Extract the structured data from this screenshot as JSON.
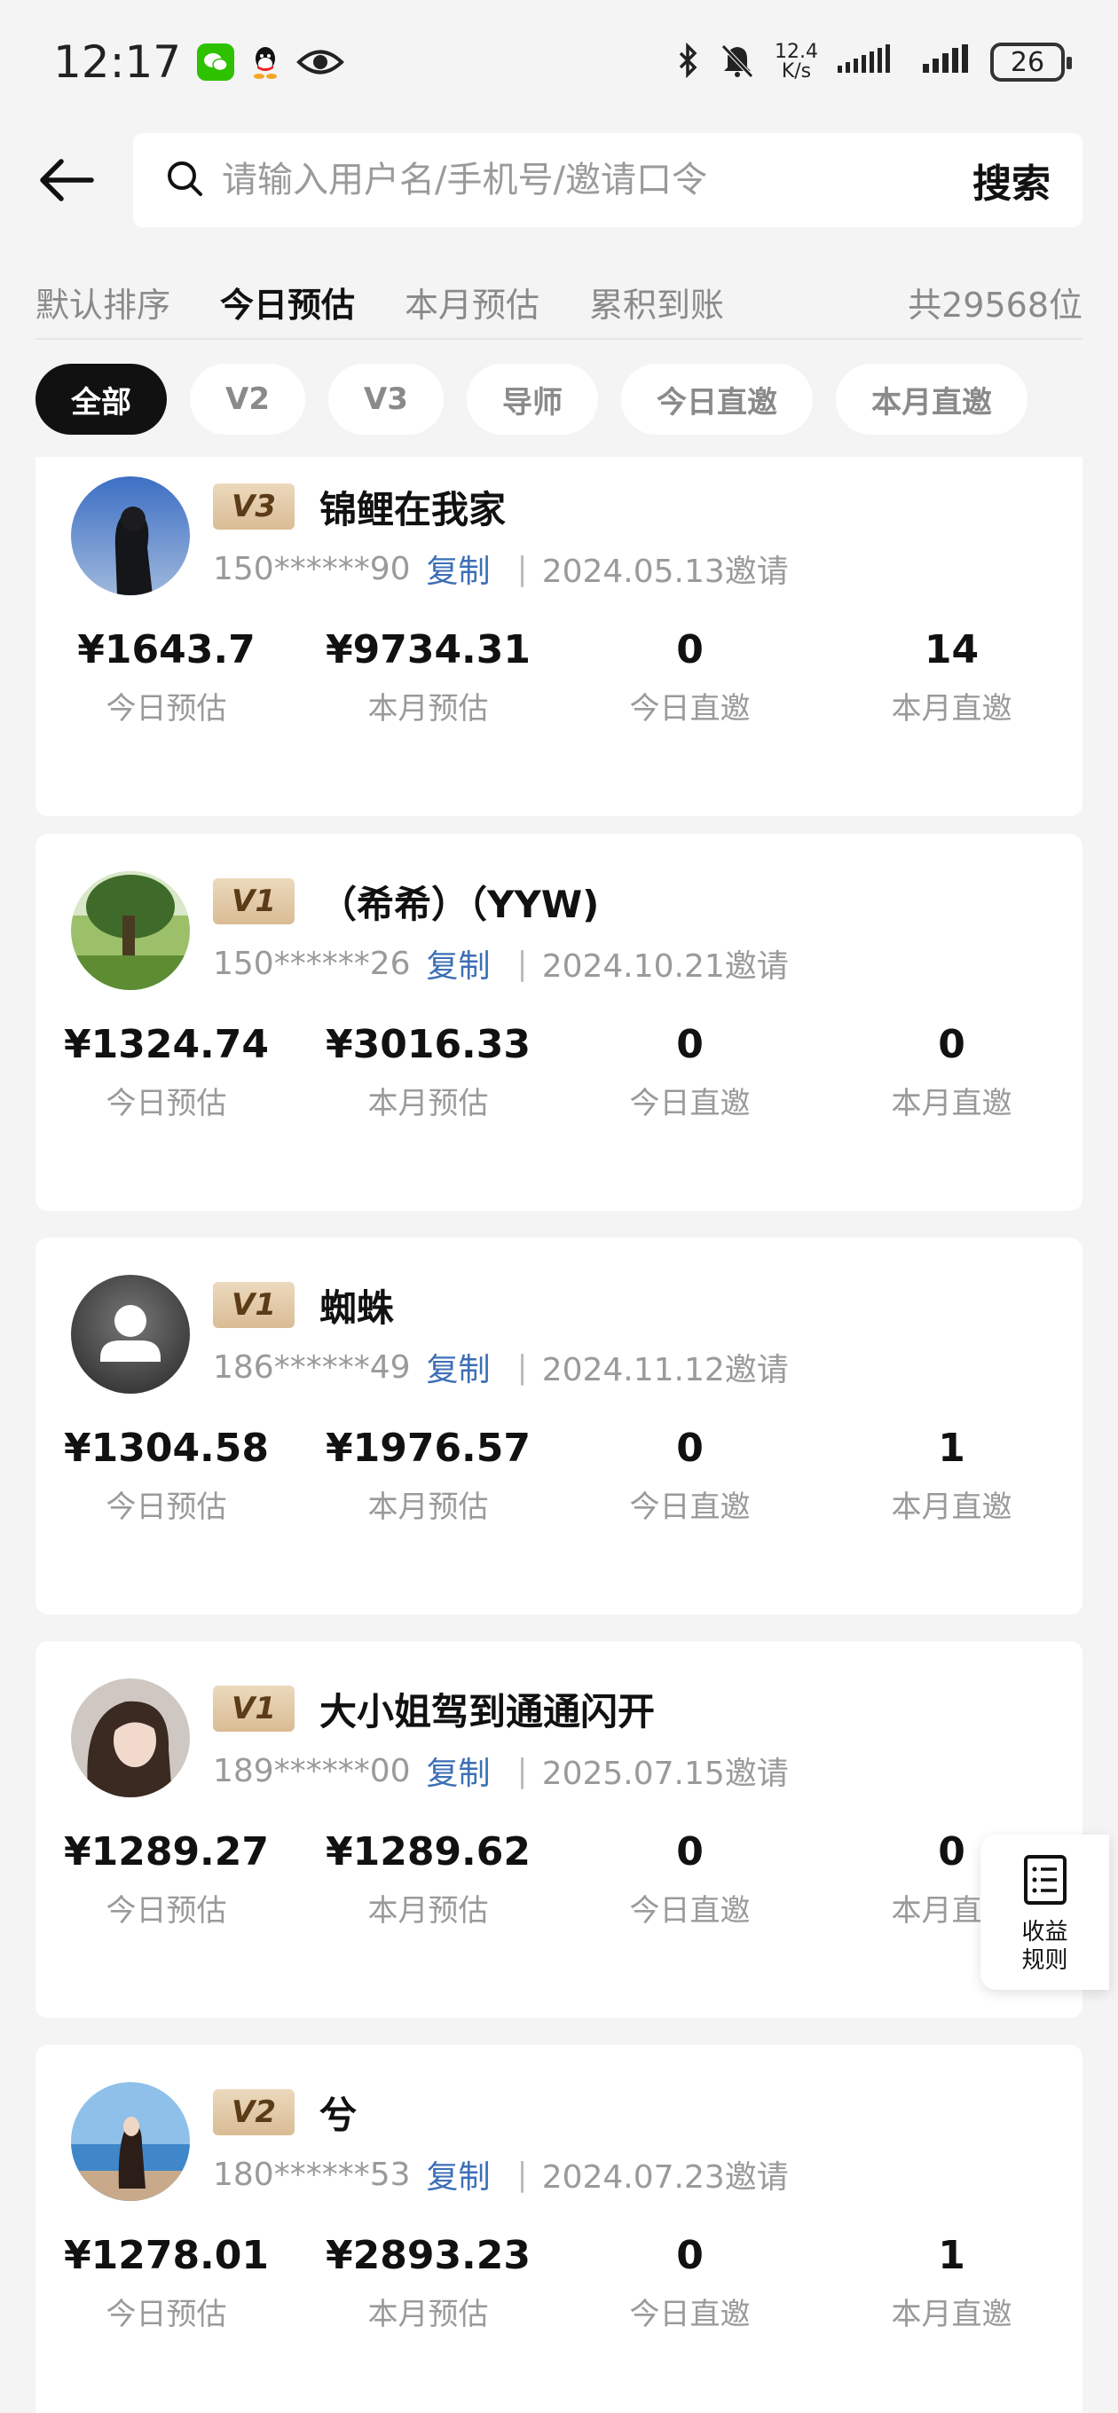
{
  "status_bar": {
    "time": "12:17",
    "net_speed_value": "12.4",
    "net_speed_unit": "K/s",
    "battery": "26"
  },
  "search": {
    "placeholder": "请输入用户名/手机号/邀请口令",
    "button": "搜索"
  },
  "sort_tabs": [
    "默认排序",
    "今日预估",
    "本月预估",
    "累积到账"
  ],
  "active_sort": "今日预估",
  "total": "共29568位",
  "filters": [
    "全部",
    "V2",
    "V3",
    "导师",
    "今日直邀",
    "本月直邀"
  ],
  "active_filter": "全部",
  "stat_labels": [
    "今日预估",
    "本月预估",
    "今日直邀",
    "本月直邀"
  ],
  "copy_label": "复制",
  "members": [
    {
      "level": "V3",
      "name": "锦鲤在我家",
      "phone": "150******90",
      "invite": "2024.05.13邀请",
      "today_est": "¥1643.7",
      "month_est": "¥9734.31",
      "today_direct": "0",
      "month_direct": "14",
      "avatar": "photo-dark-hair"
    },
    {
      "level": "V1",
      "name": "（希希）（YYW)",
      "phone": "150******26",
      "invite": "2024.10.21邀请",
      "today_est": "¥1324.74",
      "month_est": "¥3016.33",
      "today_direct": "0",
      "month_direct": "0",
      "avatar": "photo-trees"
    },
    {
      "level": "V1",
      "name": "蜘蛛",
      "phone": "186******49",
      "invite": "2024.11.12邀请",
      "today_est": "¥1304.58",
      "month_est": "¥1976.57",
      "today_direct": "0",
      "month_direct": "1",
      "avatar": "default-user"
    },
    {
      "level": "V1",
      "name": "大小姐驾到通通闪开",
      "phone": "189******00",
      "invite": "2025.07.15邀请",
      "today_est": "¥1289.27",
      "month_est": "¥1289.62",
      "today_direct": "0",
      "month_direct": "0",
      "avatar": "photo-portrait"
    },
    {
      "level": "V2",
      "name": "兮",
      "phone": "180******53",
      "invite": "2024.07.23邀请",
      "today_est": "¥1278.01",
      "month_est": "¥2893.23",
      "today_direct": "0",
      "month_direct": "1",
      "avatar": "photo-sea"
    }
  ],
  "float_button": {
    "label": "收益规则",
    "icon": "document-list-icon"
  },
  "colors": {
    "accent_blue": "#3d6fb6",
    "badge_gold": "#d9bc95",
    "chip_active": "#111111",
    "wechat_green": "#2dc100"
  }
}
